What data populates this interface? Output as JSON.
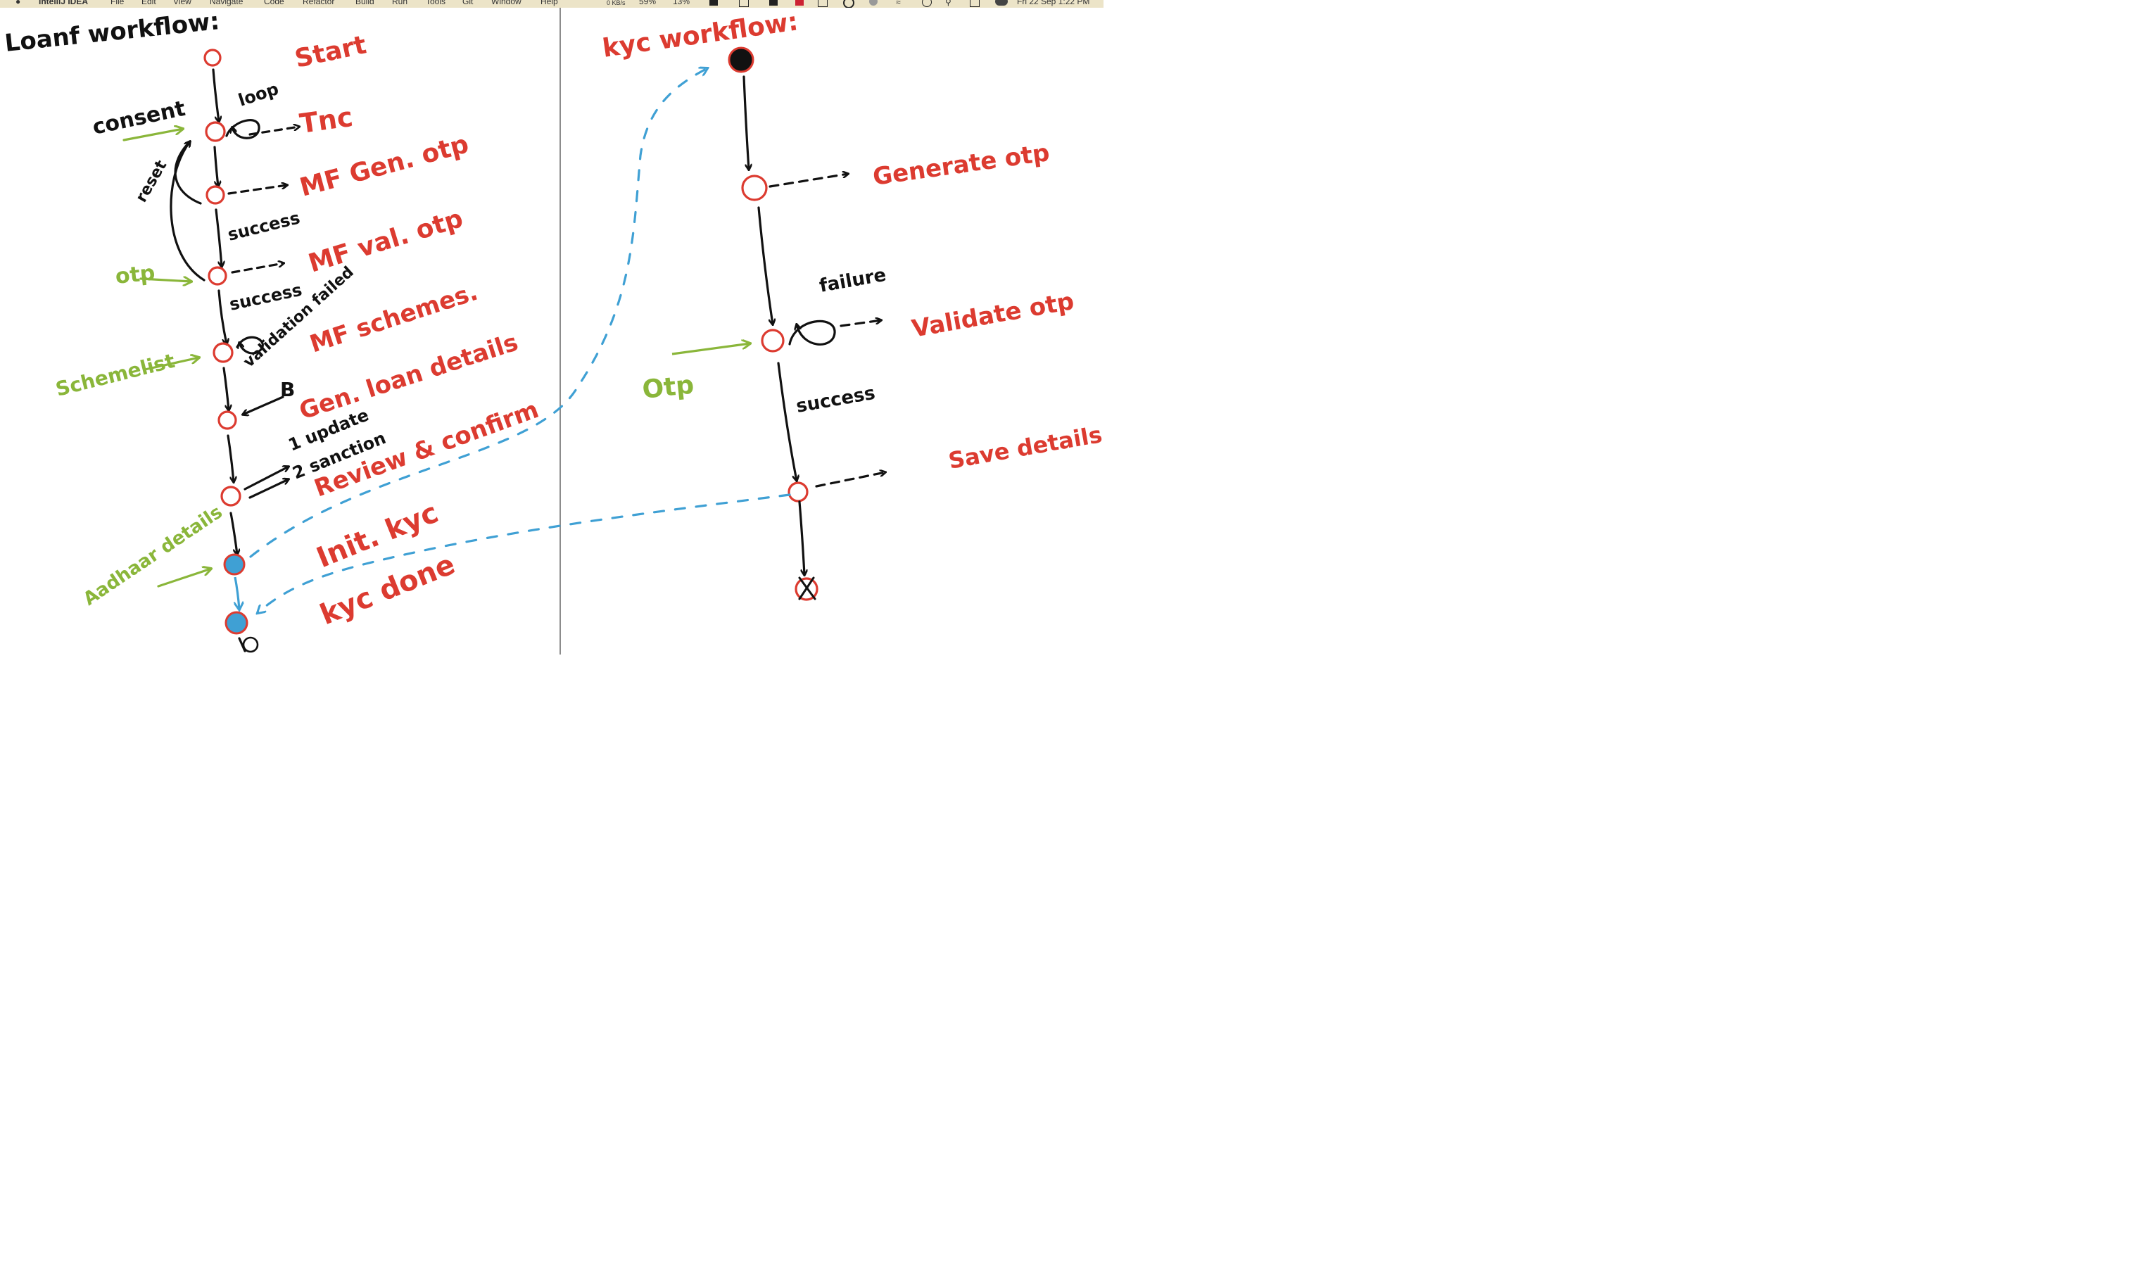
{
  "menubar": {
    "app_name": "IntelliJ IDEA",
    "menu_items": [
      "File",
      "Edit",
      "View",
      "Navigate",
      "Code",
      "Refactor",
      "Build",
      "Run",
      "Tools",
      "Git",
      "Window",
      "Help"
    ],
    "network_speed": "0 KB/s",
    "stat_1": "59%",
    "stat_2": "13%",
    "datetime": "Fri 22 Sep  1:22 PM"
  },
  "loan_workflow": {
    "title": "Loanf workflow:",
    "steps": [
      "Start",
      "Tnc",
      "MF Gen. otp",
      "MF val. otp",
      "MF schemes.",
      "Gen. loan details",
      "Review & confirm",
      "Init. kyc",
      "kyc done"
    ],
    "inputs": [
      "consent",
      "otp",
      "Schemelist",
      "Aadhaar details"
    ],
    "annotations": [
      "loop",
      "reset",
      "success",
      "success",
      "validation failed",
      "1 update",
      "2 sanction"
    ]
  },
  "kyc_workflow": {
    "title": "kyc workflow:",
    "steps": [
      "Generate otp",
      "Validate otp",
      "Save details"
    ],
    "inputs": [
      "Otp"
    ],
    "annotations": [
      "failure",
      "success"
    ]
  },
  "colors": {
    "ink": "#111111",
    "step_red": "#dc3b30",
    "input_green": "#8ab63a",
    "link_blue": "#3fa0d4",
    "divider": "#8c8c8c"
  }
}
